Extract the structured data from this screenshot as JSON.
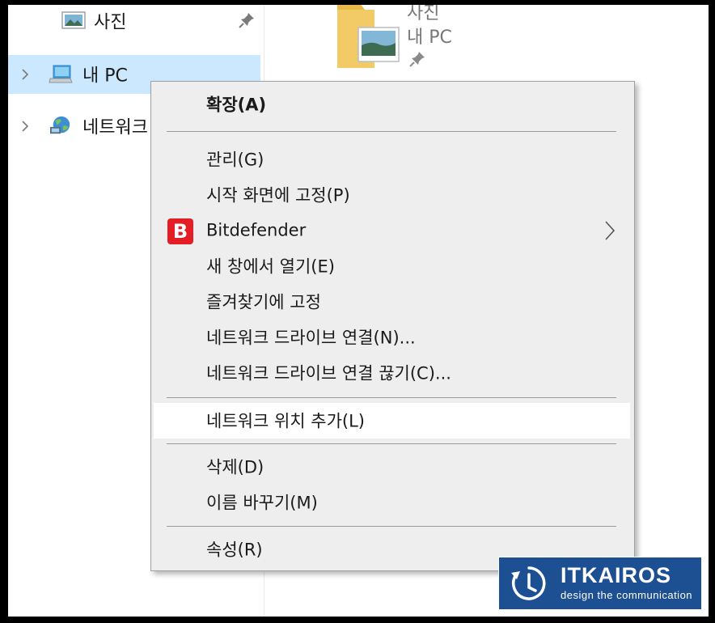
{
  "nav": {
    "items": [
      {
        "label": "사진",
        "icon": "pictures-icon",
        "pinned": true
      },
      {
        "label": "내 PC",
        "icon": "this-pc-icon",
        "selected": true
      },
      {
        "label": "네트워크",
        "icon": "network-icon"
      }
    ]
  },
  "content": {
    "folder_name": "사진",
    "folder_location": "내 PC"
  },
  "context_menu": {
    "items": [
      {
        "label": "확장(A)",
        "bold": true
      },
      {
        "label": "관리(G)"
      },
      {
        "label": "시작 화면에 고정(P)"
      },
      {
        "label": "Bitdefender",
        "icon_letter": "B",
        "has_submenu": true
      },
      {
        "label": "새 창에서 열기(E)"
      },
      {
        "label": "즐겨찾기에 고정"
      },
      {
        "label": "네트워크 드라이브 연결(N)..."
      },
      {
        "label": "네트워크 드라이브 연결 끊기(C)..."
      },
      {
        "label": "네트워크 위치 추가(L)",
        "hovered": true
      },
      {
        "label": "삭제(D)"
      },
      {
        "label": "이름 바꾸기(M)"
      },
      {
        "label": "속성(R)"
      }
    ]
  },
  "watermark": {
    "title": "ITKAIROS",
    "subtitle": "design the communication"
  },
  "colors": {
    "selection": "#cce8ff",
    "menu_bg": "#eeeeee",
    "bitdefender_red": "#e31e24",
    "watermark_blue": "#1d4f93"
  }
}
